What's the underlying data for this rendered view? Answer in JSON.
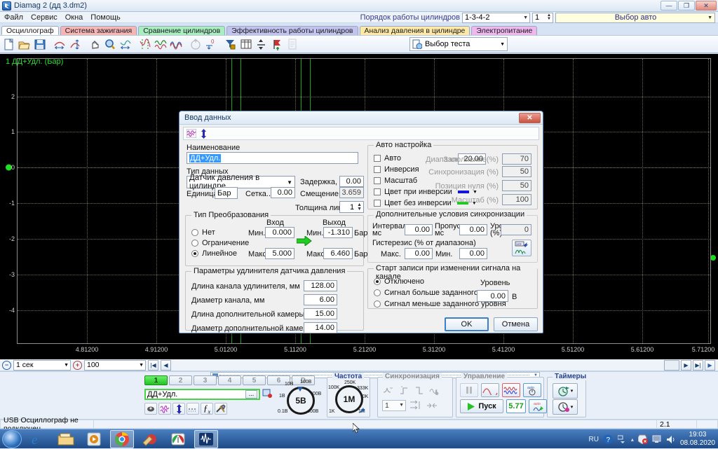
{
  "window": {
    "title": "Diamag 2 (дд 3.dm2)",
    "minimize": "—",
    "maximize": "❐",
    "close": "✕"
  },
  "menubar": {
    "items": [
      "Файл",
      "Сервис",
      "Окна",
      "Помощь"
    ]
  },
  "header": {
    "order_label": "Порядок работы цилиндров",
    "order_value": "1-3-4-2",
    "cylinder_value": "1",
    "auto_select": "Выбор авто"
  },
  "tabs": [
    {
      "label": "Осциллограф",
      "bg": "#ffffff",
      "active": true
    },
    {
      "label": "Система зажигания",
      "bg": "#f6b6b6",
      "active": false
    },
    {
      "label": "Сравнение цилиндров",
      "bg": "#a9eec0",
      "active": false
    },
    {
      "label": "Эффективность работы цилиндров",
      "bg": "#c3c3f0",
      "active": false
    },
    {
      "label": "Анализ давления в цилиндре",
      "bg": "#ffe9a8",
      "active": false
    },
    {
      "label": "Электропитание",
      "bg": "#eeb8ee",
      "active": false
    }
  ],
  "toolbar": {
    "icons": [
      "new-file-icon",
      "open-folder-icon",
      "save-disk-icon",
      "scale-horizontal-icon",
      "scale-vertical-icon",
      "hand-pan-icon",
      "zoom-magnifier-icon",
      "fit-width-icon",
      "cursor-measure-icon",
      "waveform-multi-icon",
      "waveform-pair-icon",
      "auto-scale-icon",
      "zero-level-icon",
      "filter-icon",
      "table-icon",
      "split-icon",
      "marker-flag-icon",
      "report-page-icon"
    ],
    "test_select": "Выбор теста",
    "test_select_icon": "select-test-icon"
  },
  "plot": {
    "channel_title": "1 ДД+Удл. (Бар)",
    "y_ticks": [
      "2",
      "1",
      "0",
      "-1",
      "-2",
      "-3",
      "-4"
    ],
    "x_ticks": [
      "4.81200",
      "4.91200",
      "5.01200",
      "5.11200",
      "5.21200",
      "5.31200",
      "5.41200",
      "5.51200",
      "5.61200",
      "5.71200"
    ],
    "trace_color": "#27e02a",
    "bg_color": "#000000"
  },
  "chart_data": {
    "type": "line",
    "title": "1 ДД+Удл. (Бар)",
    "xlabel": "",
    "ylabel": "Бар",
    "xlim": [
      4.762,
      5.762
    ],
    "ylim": [
      -4.6,
      2.6
    ],
    "x_ticks": [
      4.812,
      4.912,
      5.012,
      5.112,
      5.212,
      5.312,
      5.412,
      5.512,
      5.612,
      5.712
    ],
    "y_ticks": [
      2,
      1,
      0,
      -1,
      -2,
      -3,
      -4
    ],
    "grid": true,
    "legend": "none",
    "series": [
      {
        "name": "1 ДД+Удл. (Бар)",
        "color": "#27e02a",
        "x": [],
        "values": []
      }
    ],
    "cursors": [
      5.0705,
      5.0835,
      5.1745,
      5.1875
    ],
    "zero_marker": 0
  },
  "scrollstrip": {
    "time_value": "1 сек",
    "zoom_value": "100",
    "minus_icon": "zoom-out-icon",
    "plus_icon": "zoom-in-icon",
    "nav_first": "|◀",
    "nav_prev": "◀",
    "nav_next": "▶",
    "nav_last": "▶|",
    "nav_end": "▶"
  },
  "bottom": {
    "channel_buttons": [
      "1",
      "2",
      "3",
      "4",
      "5",
      "6",
      "D"
    ],
    "active_channel": "1",
    "channel_name": "ДД+Удл.",
    "channel_more_btn": "...",
    "channel_icons": [
      "probe-icon",
      "waveform-pink-icon",
      "updown-arrow-icon",
      "dashed-line-icon",
      "fx-function-icon",
      "tools-icon"
    ],
    "voltage_knob": {
      "value": "5В",
      "labels": [
        "1В",
        "10В",
        "100В",
        "200В",
        "500В",
        "0.1В"
      ]
    },
    "frequency_group": {
      "title": "Частота",
      "value": "1M",
      "labels": [
        "100K",
        "250K",
        "333K",
        "500K",
        "1M",
        "1K"
      ]
    },
    "sync_group": {
      "title": "Синхронизация",
      "icons": [
        "sync-slope-icon",
        "rising-edge-icon",
        "falling-edge-icon",
        "sync-pick-icon",
        "sync-level-icon",
        "sync-width-icon"
      ],
      "combo_value": "1"
    },
    "control_group": {
      "title": "Управление",
      "pause_icon": "pause-icon",
      "sine_icon": "sine-wave-icon",
      "multi_icon": "multi-wave-icon",
      "auto_icon": "auto-measure-icon",
      "start_label": "Пуск",
      "start_icon": "play-icon",
      "value": "5.77",
      "auto_trig_icon": "auto-trigger-icon"
    },
    "timers_group": {
      "title": "Таймеры",
      "timer1_icon": "timer-forward-icon",
      "timer2_icon": "timer-record-icon",
      "dropdown_arrow": "▾"
    }
  },
  "statusbar": {
    "message": "USB Осциллограф не подключен",
    "version": "2.1"
  },
  "taskbar": {
    "start_icon": "windows-start-icon",
    "apps": [
      "ie-browser-icon",
      "file-explorer-icon",
      "media-player-icon",
      "chrome-icon",
      "ccleaner-icon",
      "speedfan-icon",
      "diamag-icon"
    ],
    "tray": {
      "lang": "RU",
      "help_icon": "help-icon",
      "network_icon": "network-icon",
      "show_hidden": "▴",
      "security_icon": "security-alert-icon",
      "monitor_icon": "monitor-icon",
      "volume_icon": "volume-icon",
      "time": "19:03",
      "date": "08.08.2020"
    }
  },
  "dialog": {
    "title": "Ввод данных",
    "close_label": "✕",
    "toolbar_icons": [
      "waveform-edit-icon",
      "vertical-arrows-icon"
    ],
    "name_label": "Наименование",
    "name_value": "ДД+Удл.",
    "datatype_label": "Тип данных",
    "datatype_value": "Датчик давления в цилиндре",
    "delay_label": "Задержка, мс",
    "delay_value": "0.00",
    "unit_label": "Единица..",
    "unit_value": "Бар",
    "grid_label": "Сетка..",
    "grid_value": "0.00",
    "zero_offset_label": "Смещение нуля",
    "zero_offset_value": "3.659",
    "line_width_label": "Толщина линии...",
    "line_width_value": "1",
    "transform": {
      "title": "Тип Преобразования",
      "options": [
        "Нет",
        "Ограничение",
        "Линейное"
      ],
      "selected": "Линейное",
      "input_header": "Вход",
      "output_header": "Выход",
      "min_label": "Мин.",
      "max_label": "Макс.",
      "in_min": "0.000",
      "in_max": "5.000",
      "out_min": "-1.310",
      "out_max": "6.460",
      "out_unit": "Бар",
      "arrow_icon": "green-right-arrow-icon"
    },
    "extender": {
      "title": "Параметры удлинителя датчика давления",
      "rows": [
        {
          "label": "Длина канала удлинителя, мм",
          "value": "128.00"
        },
        {
          "label": "Диаметр канала, мм",
          "value": "6.00"
        },
        {
          "label": "Длина дополнительной камеры, мм",
          "value": "15.00"
        },
        {
          "label": "Диаметр дополнительной камеры, мм",
          "value": "14.00"
        }
      ]
    },
    "autosetup": {
      "title": "Авто настройка",
      "auto_label": "Авто",
      "inversion_label": "Инверсия",
      "scale_label": "Масштаб",
      "color_inv_label": "Цвет при инверсии",
      "color_noinv_label": "Цвет без инверсии",
      "color_inv": "#1414e0",
      "color_noinv": "#17d017",
      "range_label": "Диапазон.",
      "range_value": "20.00",
      "fill_label": "Заполнение(%)",
      "fill_value": "70",
      "sync_label": "Синхронизация (%)",
      "sync_value": "50",
      "zero_pos_label": "Позиция нуля (%)",
      "zero_pos_value": "50",
      "scale_pct_label": "Масштаб (%)",
      "scale_pct_value": "100"
    },
    "sync_cond": {
      "title": "Дополнительные условия синхронизации",
      "interval_label": "Интервал, мс",
      "interval_value": "0.00",
      "skip_label": "Пропуск, мс",
      "skip_value": "0.00",
      "level_label": "Уровень (%)",
      "level_value": "0",
      "hyst_title": "Гистерезис (% от диапазона)",
      "hyst_max_label": "Макс.",
      "hyst_max_value": "0.00",
      "hyst_min_label": "Мин.",
      "hyst_min_value": "0.00",
      "tool_icon": "waveform-settings-icon"
    },
    "start_rec": {
      "title": "Старт записи при изменении сигнала на канале",
      "options": [
        "Отключено",
        "Сигнал больше заданного уровня",
        "Сигнал меньше заданного уровня"
      ],
      "selected": "Отключено",
      "level_label": "Уровень",
      "level_value": "0.00",
      "level_unit": "В"
    },
    "ok_label": "OK",
    "cancel_label": "Отмена"
  }
}
